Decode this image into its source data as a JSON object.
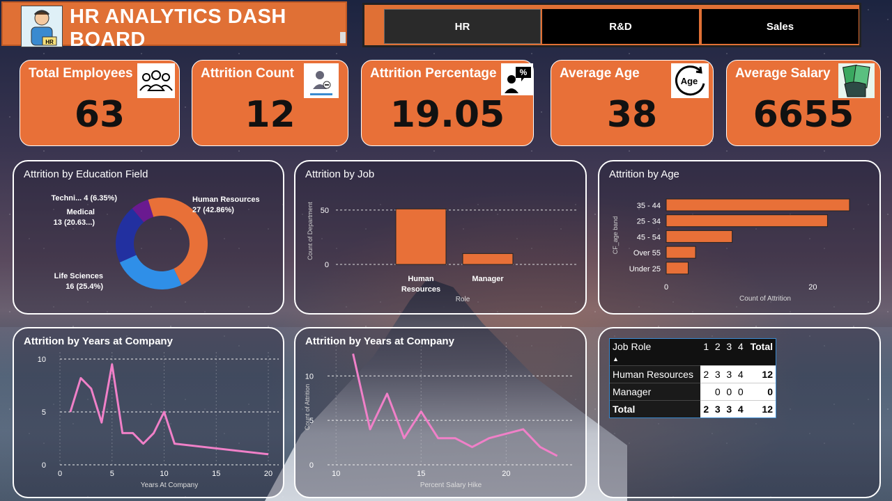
{
  "header": {
    "title": "HR ANALYTICS DASH BOARD",
    "avatar_badge": "HR"
  },
  "tabs": [
    {
      "label": "HR"
    },
    {
      "label": "R&D"
    },
    {
      "label": "Sales"
    }
  ],
  "kpis": [
    {
      "label": "Total Employees",
      "value": "63",
      "icon": "people-group-icon"
    },
    {
      "label": "Attrition Count",
      "value": "12",
      "icon": "person-remove-icon"
    },
    {
      "label": "Attrition Percentage",
      "value": "19.05",
      "icon": "percent-person-icon",
      "icon_text": "%"
    },
    {
      "label": "Average Age",
      "value": "38",
      "icon": "age-icon",
      "icon_text": "Age"
    },
    {
      "label": "Average Salary",
      "value": "6655",
      "icon": "money-hand-icon"
    }
  ],
  "panels": {
    "edu": {
      "title": "Attrition by Education Field"
    },
    "job": {
      "title": "Attrition by Job"
    },
    "age": {
      "title": "Attrition by Age"
    },
    "years": {
      "title": "Attrition by Years at Company"
    },
    "hike": {
      "title": "Attrition by Years at Company"
    }
  },
  "colors": {
    "accent": "#e07035",
    "kpi": "#e87038",
    "line": "#f080c8",
    "bar": "#e87038"
  },
  "chart_data": [
    {
      "type": "pie",
      "title": "Attrition by Education Field",
      "slices": [
        {
          "label": "Human Resources",
          "value": 27,
          "display": "27 (42.86%)",
          "color": "#e87038"
        },
        {
          "label": "Life Sciences",
          "value": 16,
          "display": "16 (25.4%)",
          "color": "#2f8fe8"
        },
        {
          "label": "Medical",
          "value": 13,
          "display": "13 (20.63...)",
          "color": "#2230a0"
        },
        {
          "label": "Techni...",
          "value": 4,
          "display": "4 (6.35%)",
          "color": "#6a1a90"
        },
        {
          "label": "",
          "value": 3,
          "display": "",
          "color": "#e87038"
        }
      ]
    },
    {
      "type": "bar",
      "title": "Attrition by Job",
      "categories": [
        "Human Resources",
        "Manager"
      ],
      "values": [
        51,
        10
      ],
      "xlabel": "Role",
      "ylabel": "Count of Department",
      "ylim": [
        0,
        55
      ],
      "yticks": [
        "0",
        "50"
      ]
    },
    {
      "type": "bar",
      "orientation": "horizontal",
      "title": "Attrition by Age",
      "categories": [
        "35 - 44",
        "25 - 34",
        "45 - 54",
        "Over 55",
        "Under 25"
      ],
      "values": [
        25,
        22,
        9,
        4,
        3
      ],
      "xlabel": "Count of Attrition",
      "ylabel": "CF_age band",
      "xlim": [
        0,
        27
      ],
      "xticks": [
        "0",
        "20"
      ]
    },
    {
      "type": "line",
      "title": "Attrition by Years at Company",
      "x": [
        1,
        2,
        3,
        4,
        5,
        6,
        7,
        8,
        9,
        10,
        11,
        20
      ],
      "y": [
        5,
        8.2,
        7.2,
        4,
        9.5,
        3,
        3,
        2,
        3,
        5,
        2,
        1
      ],
      "xlabel": "Years At Company",
      "ylabel": "",
      "xticks": [
        "0",
        "5",
        "10",
        "15",
        "20"
      ],
      "yticks": [
        "0",
        "5",
        "10"
      ],
      "xlim": [
        0,
        21
      ],
      "ylim": [
        0,
        10
      ]
    },
    {
      "type": "line",
      "title": "Attrition by Years at Company",
      "x": [
        11,
        12,
        13,
        14,
        15,
        16,
        17,
        18,
        19,
        20,
        21,
        22,
        23
      ],
      "y": [
        12.5,
        4,
        8,
        3,
        6,
        3,
        3,
        2,
        3,
        3.5,
        4,
        2,
        1
      ],
      "xlabel": "Percent Salary Hike",
      "ylabel": "Count of Attrition",
      "xticks": [
        "10",
        "15",
        "20"
      ],
      "yticks": [
        "0",
        "5",
        "10"
      ],
      "xlim": [
        9.5,
        24
      ],
      "ylim": [
        0,
        13
      ]
    }
  ],
  "matrix": {
    "header": [
      "Job Role",
      "1",
      "2",
      "3",
      "4",
      "Total"
    ],
    "rows": [
      {
        "label": "Human Resources",
        "cells": [
          "2",
          "3",
          "3",
          "4"
        ],
        "total": "12"
      },
      {
        "label": "Manager",
        "cells": [
          "",
          "0",
          "0",
          "0"
        ],
        "total": "0"
      },
      {
        "label": "Total",
        "cells": [
          "2",
          "3",
          "3",
          "4"
        ],
        "total": "12"
      }
    ]
  }
}
